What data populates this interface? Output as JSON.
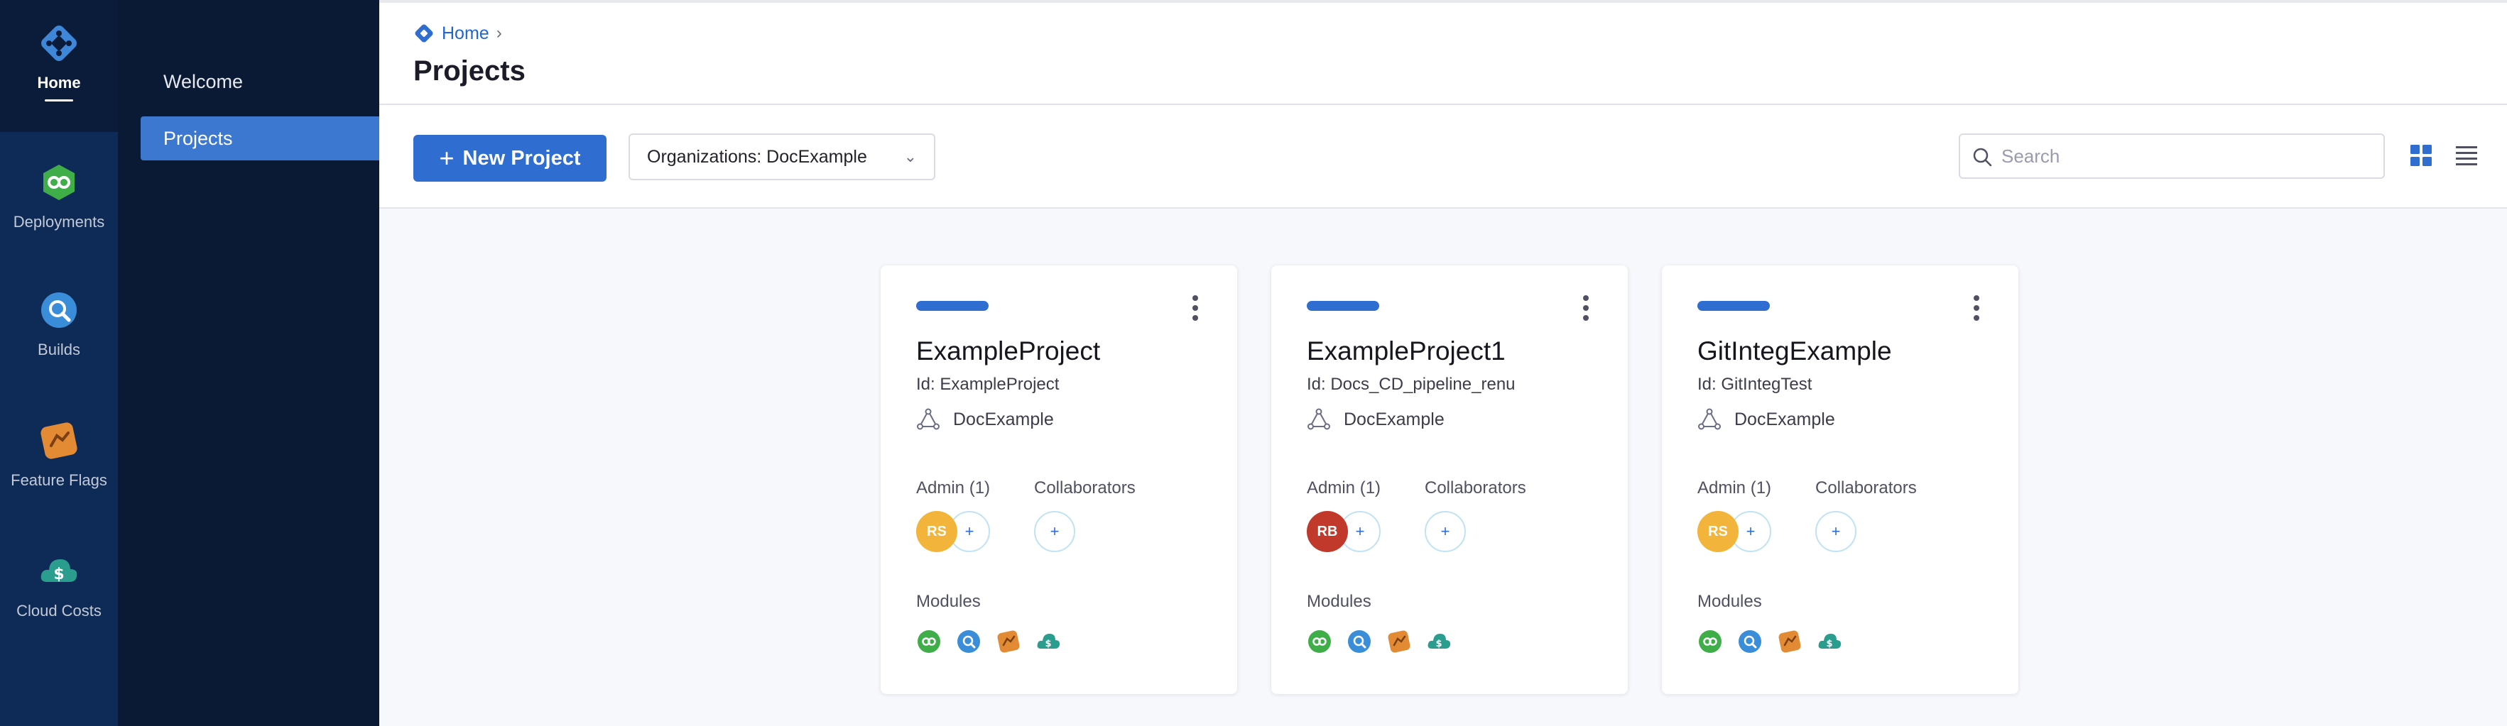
{
  "rail": {
    "items": [
      {
        "label": "Home",
        "icon": "harness-logo-icon"
      },
      {
        "label": "Deployments",
        "icon": "deployments-icon"
      },
      {
        "label": "Builds",
        "icon": "builds-icon"
      },
      {
        "label": "Feature Flags",
        "icon": "feature-flags-icon"
      },
      {
        "label": "Cloud Costs",
        "icon": "cloud-costs-icon"
      }
    ]
  },
  "subnav": {
    "items": [
      {
        "label": "Welcome",
        "active": false
      },
      {
        "label": "Projects",
        "active": true
      }
    ]
  },
  "header": {
    "breadcrumb": "Home",
    "title": "Projects"
  },
  "toolbar": {
    "new_project_label": "New Project",
    "org_select_value": "Organizations: DocExample",
    "search_placeholder": "Search"
  },
  "projects": [
    {
      "name": "ExampleProject",
      "id_text": "Id: ExampleProject",
      "org": "DocExample",
      "admin_label": "Admin (1)",
      "collaborators_label": "Collaborators",
      "admin_initials": "RS",
      "admin_color": "#f2b43b",
      "modules_label": "Modules"
    },
    {
      "name": "ExampleProject1",
      "id_text": "Id: Docs_CD_pipeline_renu",
      "org": "DocExample",
      "admin_label": "Admin (1)",
      "collaborators_label": "Collaborators",
      "admin_initials": "RB",
      "admin_color": "#c0392b",
      "modules_label": "Modules"
    },
    {
      "name": "GitIntegExample",
      "id_text": "Id: GitIntegTest",
      "org": "DocExample",
      "admin_label": "Admin (1)",
      "collaborators_label": "Collaborators",
      "admin_initials": "RS",
      "admin_color": "#f2b43b",
      "modules_label": "Modules"
    }
  ],
  "colors": {
    "accent": "#2f6dd0",
    "rail_bg": "#0b1c3b",
    "subnav_active": "#3c78d0"
  }
}
